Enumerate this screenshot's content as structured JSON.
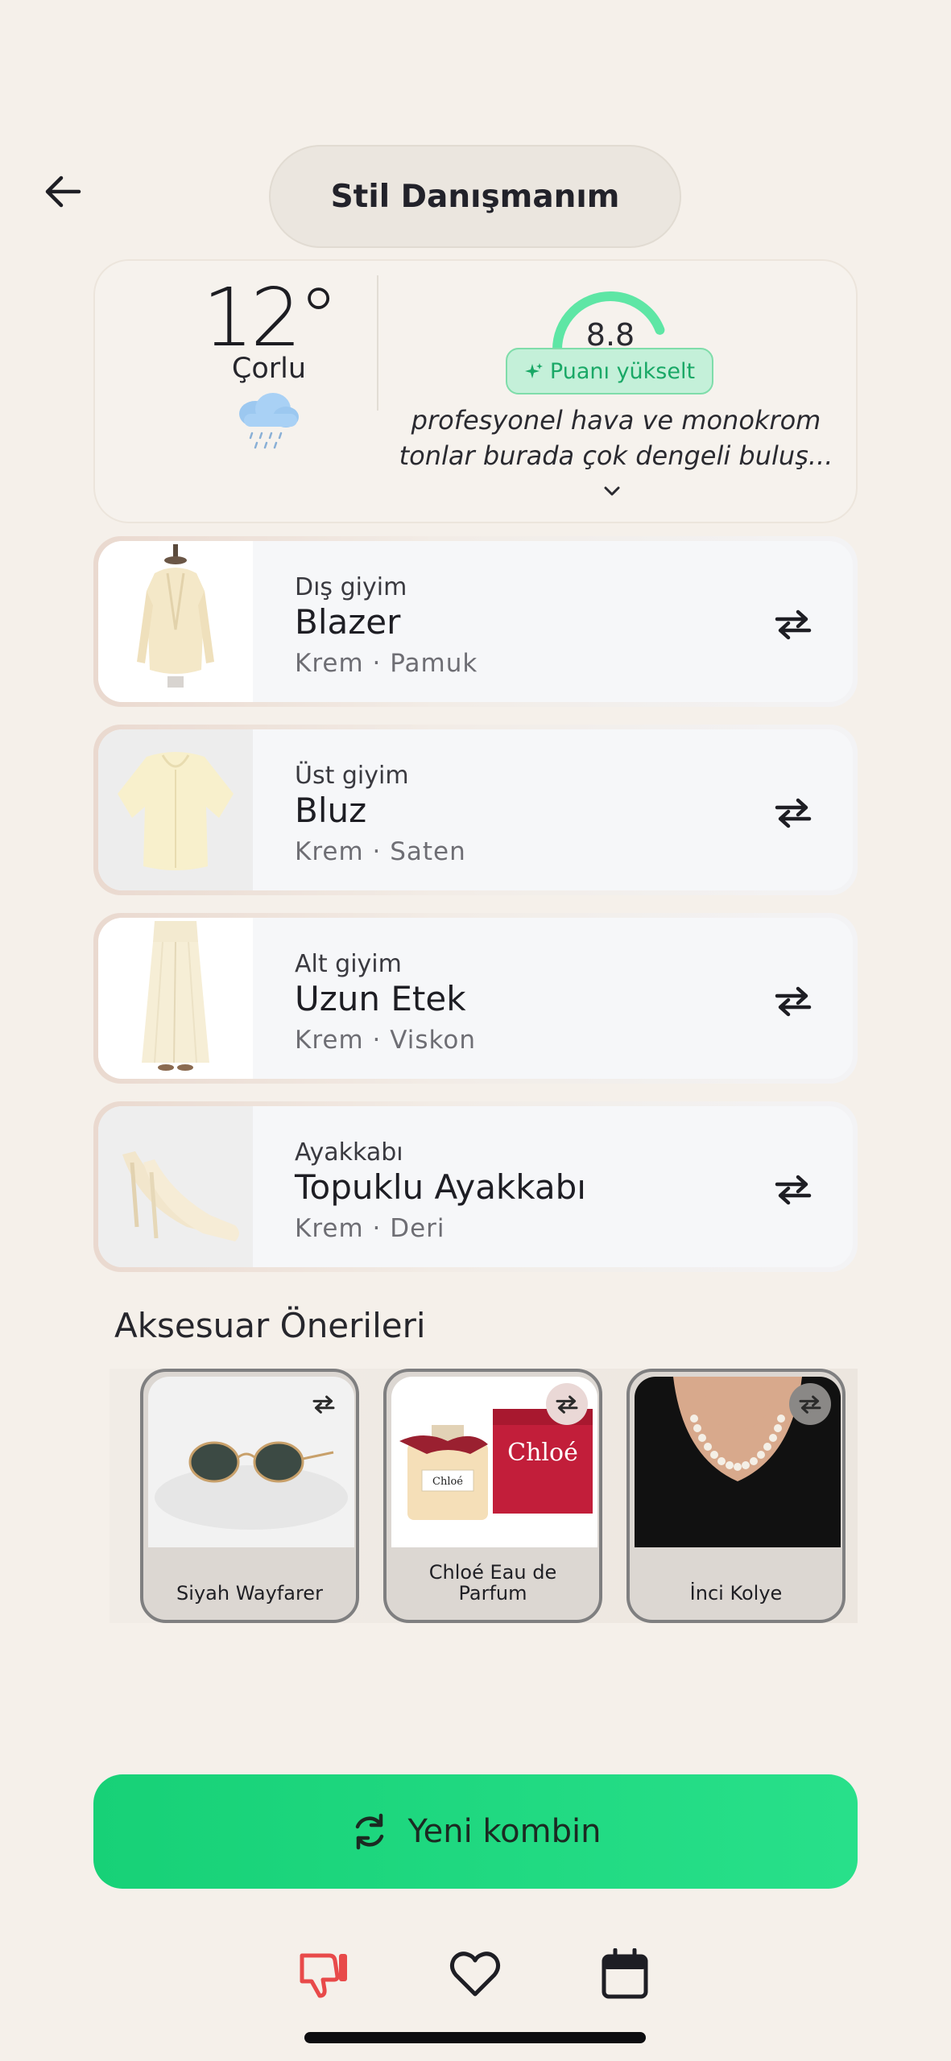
{
  "header": {
    "title": "Stil Danışmanım",
    "back_icon": "arrow-left-icon"
  },
  "weather": {
    "temperature": "12°",
    "city": "Çorlu",
    "icon": "rain-cloud-icon"
  },
  "score": {
    "value": "8.8",
    "gauge_fraction": 0.88,
    "boost_label": "Puanı yükselt",
    "description_line1": "profesyonel hava ve monokrom",
    "description_line2": "tonlar burada çok dengeli buluş...",
    "expand_icon": "chevron-down-icon"
  },
  "items": [
    {
      "category": "Dış giyim",
      "name": "Blazer",
      "meta": "Krem · Pamuk"
    },
    {
      "category": "Üst giyim",
      "name": "Bluz",
      "meta": "Krem · Saten"
    },
    {
      "category": "Alt giyim",
      "name": "Uzun Etek",
      "meta": "Krem · Viskon"
    },
    {
      "category": "Ayakkabı",
      "name": "Topuklu Ayakkabı",
      "meta": "Krem · Deri"
    }
  ],
  "accessories": {
    "title": "Aksesuar Önerileri",
    "items": [
      {
        "name": "Siyah Wayfarer"
      },
      {
        "name": "Chloé Eau de Parfum",
        "brand_box": "Chloé",
        "brand_bottle": "Chloé"
      },
      {
        "name": "İnci Kolye"
      }
    ]
  },
  "actions": {
    "new_combo_label": "Yeni kombin"
  },
  "bottom_bar": [
    "thumbs-down-icon",
    "heart-icon",
    "calendar-icon"
  ],
  "colors": {
    "background": "#f5f0ea",
    "accent_green": "#1fd97f",
    "gauge_green": "#5ee6a5",
    "dislike_red": "#e84a4a"
  }
}
